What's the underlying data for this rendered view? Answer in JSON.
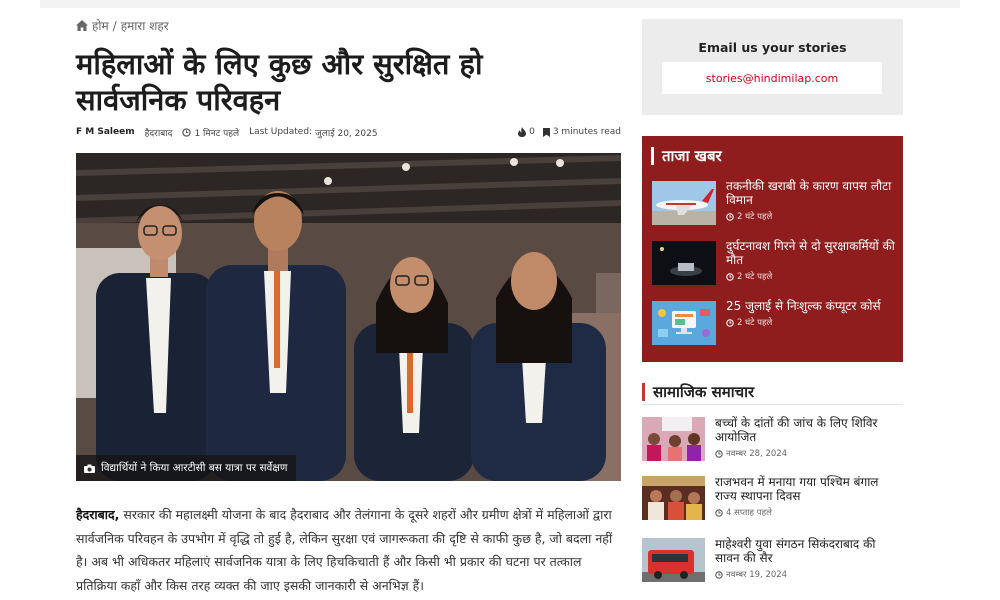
{
  "breadcrumb": {
    "home": "होम",
    "separator": "/",
    "current": "हमारा शहर"
  },
  "article": {
    "title": "महिलाओं के लिए कुछ और सुरक्षित हो सार्वजनिक परिवहन",
    "author": "F M Saleem",
    "city": "हैदराबाद",
    "posted": "1 मिनट पहले",
    "updated_label": "Last Updated:",
    "updated_date": "जुलाई 20, 2025",
    "hot_count": "0",
    "read_time": "3 minutes read",
    "image_caption": "विद्यार्थियों ने किया आरटीसी बस यात्रा पर सर्वेक्षण",
    "lead_city": "हैदराबाद,",
    "body": "सरकार की महालक्ष्मी योजना के बाद हैदराबाद और तेलंगाना के दूसरे शहरों और ग्रमीण क्षेत्रों में महिलाओं द्वारा सार्वजनिक परिवहन के उपभोग में वृद्धि तो हुई है, लेकिन सुरक्षा एवं जागरूकता की दृष्टि से काफी कुछ है, जो बदला नहीं है। अब भी अधिकतर महिलाएं सार्वजनिक यात्रा के लिए हिचकिचाती हैं और किसी भी प्रकार की घटना पर तत्काल प्रतिक्रिया कहाँ और किस तरह व्यक्त की जाए इसकी जानकारी से अनभिज्ञ हैं।"
  },
  "email_box": {
    "title": "Email us your stories",
    "email": "stories@hindimilap.com"
  },
  "latest_news": {
    "heading": "ताजा खबर",
    "items": [
      {
        "title": "तकनीकी खराबी के कारण वापस लौटा विमान",
        "time": "2 घंटे पहले",
        "icon": "airplane"
      },
      {
        "title": "दुर्घटनावश गिरने से दो सुरक्षाकर्मियों की मौत",
        "time": "2 घंटे पहले",
        "icon": "night-scene"
      },
      {
        "title": "25 जुलाई से निःशुल्क कंप्यूटर कोर्स",
        "time": "2 घंटे पहले",
        "icon": "computer-illustration"
      }
    ]
  },
  "social_news": {
    "heading": "सामाजिक समाचार",
    "items": [
      {
        "title": "बच्चों के दांतों की जांच के लिए शिविर आयोजित",
        "time": "नवम्बर 28, 2024"
      },
      {
        "title": "राजभवन में मनाया गया पश्चिम बंगाल राज्य स्थापना दिवस",
        "time": "4 सप्ताह पहले"
      },
      {
        "title": "माहेश्वरी युवा संगठन सिकंदराबाद की सावन की सैर",
        "time": "नवम्बर 19, 2024"
      }
    ]
  },
  "colors": {
    "accent_red": "#8f1d1d",
    "link_red": "#d0021b",
    "panel_grey": "#ececec"
  }
}
